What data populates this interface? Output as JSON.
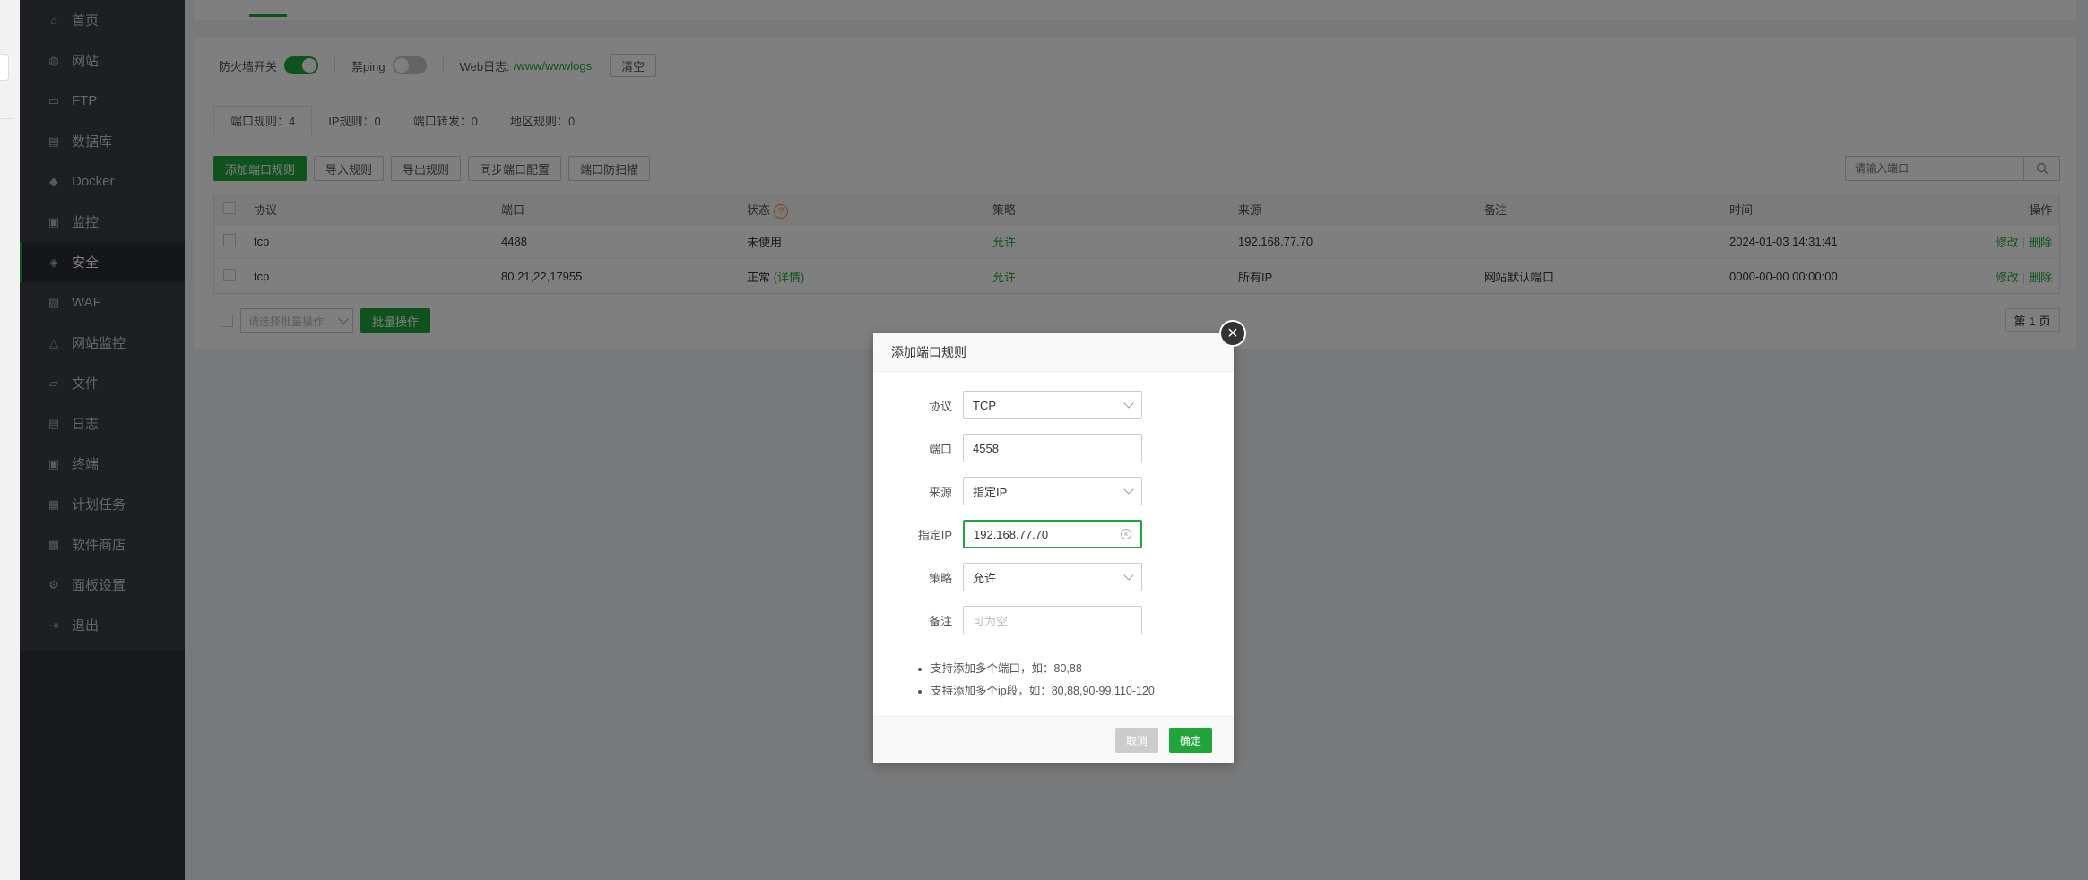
{
  "sidebar": {
    "items": [
      {
        "label": "首页",
        "icon": "home-icon",
        "glyph": "⌂"
      },
      {
        "label": "网站",
        "icon": "globe-icon",
        "glyph": "◍"
      },
      {
        "label": "FTP",
        "icon": "ftp-icon",
        "glyph": "▭"
      },
      {
        "label": "数据库",
        "icon": "database-icon",
        "glyph": "▤"
      },
      {
        "label": "Docker",
        "icon": "docker-icon",
        "glyph": "◆"
      },
      {
        "label": "监控",
        "icon": "monitor-icon",
        "glyph": "▣"
      },
      {
        "label": "安全",
        "icon": "shield-icon",
        "glyph": "◈"
      },
      {
        "label": "WAF",
        "icon": "waf-icon",
        "glyph": "▨"
      },
      {
        "label": "网站监控",
        "icon": "chart-icon",
        "glyph": "△"
      },
      {
        "label": "文件",
        "icon": "folder-icon",
        "glyph": "▱"
      },
      {
        "label": "日志",
        "icon": "log-icon",
        "glyph": "▤"
      },
      {
        "label": "终端",
        "icon": "terminal-icon",
        "glyph": "▣"
      },
      {
        "label": "计划任务",
        "icon": "task-icon",
        "glyph": "▦"
      },
      {
        "label": "软件商店",
        "icon": "store-icon",
        "glyph": "▩"
      },
      {
        "label": "面板设置",
        "icon": "gear-icon",
        "glyph": "⚙"
      },
      {
        "label": "退出",
        "icon": "logout-icon",
        "glyph": "⇥"
      }
    ],
    "active_index": 6
  },
  "firewall": {
    "switch_label": "防火墙开关",
    "ping_label": "禁ping",
    "weblog_label": "Web日志:",
    "weblog_path": "/www/wwwlogs",
    "clear_label": "清空"
  },
  "tabs": [
    {
      "label": "端口规则：4"
    },
    {
      "label": "IP规则：0"
    },
    {
      "label": "端口转发：0"
    },
    {
      "label": "地区规则：0"
    }
  ],
  "toolbar": {
    "add": "添加端口规则",
    "import": "导入规则",
    "export": "导出规则",
    "sync": "同步端口配置",
    "scan": "端口防扫描",
    "search_placeholder": "请输入端口"
  },
  "table": {
    "headers": {
      "protocol": "协议",
      "port": "端口",
      "status": "状态",
      "policy": "策略",
      "source": "来源",
      "note": "备注",
      "time": "时间",
      "ops": "操作"
    },
    "rows": [
      {
        "protocol": "tcp",
        "port": "4488",
        "status": "未使用",
        "detail": "",
        "policy": "允许",
        "source": "192.168.77.70",
        "note": "",
        "time": "2024-01-03 14:31:41",
        "edit": "修改",
        "delete": "删除"
      },
      {
        "protocol": "tcp",
        "port": "80,21,22,17955",
        "status": "正常",
        "detail": "(详情)",
        "policy": "允许",
        "source": "所有IP",
        "note": "网站默认端口",
        "time": "0000-00-00 00:00:00",
        "edit": "修改",
        "delete": "删除"
      }
    ],
    "status_help": "?",
    "op_sep": "|"
  },
  "bottom": {
    "bulk_placeholder": "请选择批量操作",
    "bulk_button": "批量操作",
    "page": "第 1 页"
  },
  "modal": {
    "title": "添加端口规则",
    "close": "×",
    "fields": {
      "protocol_label": "协议",
      "protocol_value": "TCP",
      "port_label": "端口",
      "port_value": "4558",
      "source_label": "来源",
      "source_value": "指定IP",
      "ip_label": "指定IP",
      "ip_value": "192.168.77.70",
      "policy_label": "策略",
      "policy_value": "允许",
      "note_label": "备注",
      "note_placeholder": "可为空"
    },
    "tips": [
      "支持添加多个端口，如：80,88",
      "支持添加多个ip段，如：80,88,90-99,110-120"
    ],
    "cancel": "取消",
    "confirm": "确定"
  },
  "colors": {
    "accent": "#20a53a",
    "sidebar": "#2f3238",
    "warning": "#f08a24"
  }
}
